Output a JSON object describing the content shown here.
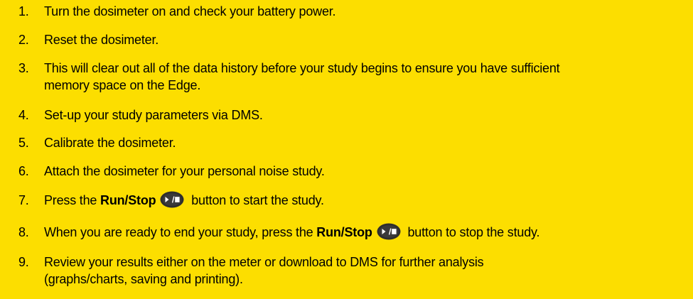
{
  "steps": [
    {
      "number": "1.",
      "text": "Turn the dosimeter on and check your battery power."
    },
    {
      "number": "2.",
      "text": "Reset the dosimeter."
    },
    {
      "number": "3.",
      "line1": "This will clear out all of the data history before your study begins to ensure you have sufficient",
      "line2": "memory space on the Edge."
    },
    {
      "number": "4.",
      "text": "Set-up your study parameters via DMS."
    },
    {
      "number": "5.",
      "text": "Calibrate the dosimeter."
    },
    {
      "number": "6.",
      "text": "Attach the dosimeter for your personal noise study."
    },
    {
      "number": "7.",
      "before": "Press the ",
      "bold": "Run/Stop",
      "after": " button to start the study."
    },
    {
      "number": "8.",
      "before": "When you are ready to end your study, press the ",
      "bold": "Run/Stop",
      "after": " button to stop the study."
    },
    {
      "number": "9.",
      "line1": "Review your results either on the meter or download to DMS for further analysis",
      "line2": "(graphs/charts, saving and printing)."
    }
  ],
  "icons": {
    "run_stop": "run-stop-button-icon"
  },
  "colors": {
    "background": "#fcde00",
    "icon_dark": "#2e2e2e"
  }
}
